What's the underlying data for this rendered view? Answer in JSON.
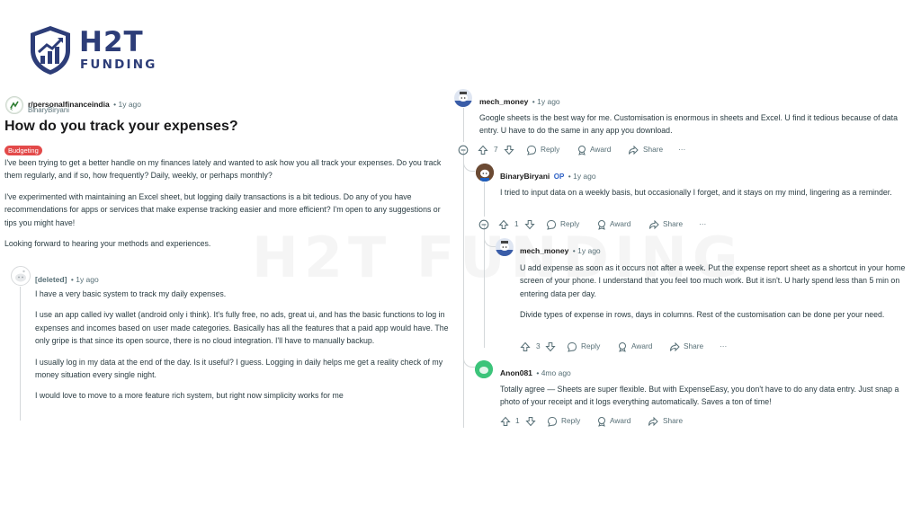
{
  "brand": {
    "line1": "H2T",
    "line2": "FUNDING",
    "watermark": "H2T FUNDING",
    "color": "#2d3d78"
  },
  "post": {
    "subreddit": "r/personalfinanceindia",
    "time": "• 1y ago",
    "author": "BinaryBiryani",
    "title": "How do you track your expenses?",
    "flair": "Budgeting",
    "flair_color": "#e34a4a",
    "paragraphs": [
      "I've been trying to get a better handle on my finances lately and wanted to ask how you all track your expenses. Do you track them regularly, and if so, how frequently? Daily, weekly, or perhaps monthly?",
      "I've experimented with maintaining an Excel sheet, but logging daily transactions is a bit tedious. Do any of you have recommendations for apps or services that make expense tracking easier and more efficient? I'm open to any suggestions or tips you might have!",
      "Looking forward to hearing your methods and experiences."
    ]
  },
  "comments": {
    "deleted": {
      "author": "[deleted]",
      "time": "• 1y ago",
      "paragraphs": [
        "I have a very basic system to track my daily expenses.",
        "I use an app called ivy wallet (android only i think). It's fully free, no ads, great ui, and has the basic functions to log in expenses and incomes based on user made categories. Basically has all the features that a paid app would have. The only gripe is that since its open source, there is no cloud integration. I'll have to manually backup.",
        "I usually log in my data at the end of the day. Is it useful? I guess. Logging in daily helps me get a reality check of my money situation every single night.",
        "I would love to move to a more feature rich system, but right now simplicity works for me"
      ]
    },
    "mech1": {
      "author": "mech_money",
      "time": "• 1y ago",
      "text": "Google sheets is the best way for me. Customisation is enormous in sheets and Excel. U find it tedious because of data entry. U have to do the same in any app you download.",
      "votes": "7"
    },
    "op_reply": {
      "author": "BinaryBiryani",
      "op": "OP",
      "time": "• 1y ago",
      "text": "I tried to input data on a weekly basis, but occasionally I forget, and it stays on my mind, lingering as a reminder.",
      "votes": "1"
    },
    "mech2": {
      "author": "mech_money",
      "time": "• 1y ago",
      "paragraphs": [
        "U add expense as soon as it occurs not after a week. Put the expense report sheet as a shortcut in your home screen of your phone. I understand that you feel too much work. But it isn't. U harly spend less than 5 min on entering data per day.",
        "Divide types of expense in rows, days in columns. Rest of the customisation can be done per your need."
      ],
      "votes": "3"
    },
    "anon": {
      "author": "Anon081",
      "time": "• 4mo ago",
      "text": "Totally agree — Sheets are super flexible. But with ExpenseEasy, you don't have to do any data entry. Just snap a photo of your receipt and it logs everything automatically. Saves a ton of time!",
      "votes": "1"
    }
  },
  "actions": {
    "reply": "Reply",
    "award": "Award",
    "share": "Share",
    "more": "···"
  }
}
